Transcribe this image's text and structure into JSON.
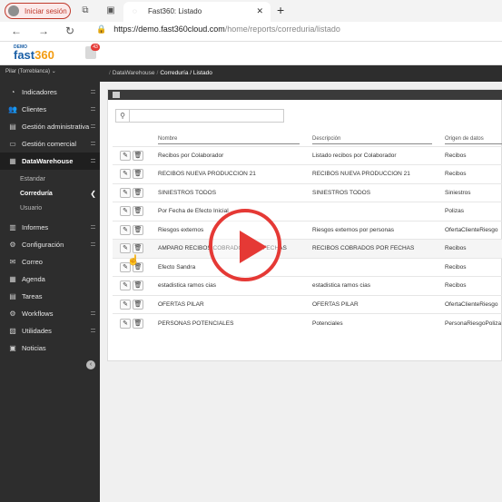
{
  "browser": {
    "signin_label": "Iniciar sesión",
    "tab_title": "Fast360: Listado",
    "tab_close": "✕",
    "new_tab": "+",
    "url_domain": "https://demo.fast360cloud.com",
    "url_path": "/home/reports/correduria/listado"
  },
  "header": {
    "logo_demo": "DEMO",
    "logo_fast": "fast",
    "logo_360": "360",
    "notif_count": "43"
  },
  "sidebar": {
    "user": "Pilar (Torreblanca)",
    "items": [
      {
        "label": "Indicadores",
        "icon": "dashboard-icon"
      },
      {
        "label": "Clientes",
        "icon": "users-icon"
      },
      {
        "label": "Gestión administrativa",
        "icon": "briefcase-icon"
      },
      {
        "label": "Gestión comercial",
        "icon": "monitor-icon"
      },
      {
        "label": "DataWarehouse",
        "icon": "database-icon"
      }
    ],
    "subitems": [
      "Estandar",
      "Correduría",
      "Usuario"
    ],
    "items2": [
      {
        "label": "Informes",
        "icon": "report-icon"
      },
      {
        "label": "Configuración",
        "icon": "gear-icon"
      },
      {
        "label": "Correo",
        "icon": "mail-icon"
      },
      {
        "label": "Agenda",
        "icon": "calendar-icon"
      },
      {
        "label": "Tareas",
        "icon": "tasks-icon"
      },
      {
        "label": "Workflows",
        "icon": "workflow-icon"
      },
      {
        "label": "Utilidades",
        "icon": "tools-icon"
      },
      {
        "label": "Noticias",
        "icon": "news-icon"
      }
    ]
  },
  "breadcrumb": {
    "part1": "DataWarehouse",
    "part2": "Correduría / Listado"
  },
  "table": {
    "headers": [
      "Nombre",
      "Descripción",
      "Origen de datos"
    ],
    "rows": [
      {
        "name": "Recibos por Colaborador",
        "desc": "Listado recibos por Colaborador",
        "origin": "Recibos"
      },
      {
        "name": "RECIBOS NUEVA PRODUCCION 21",
        "desc": "RECIBOS NUEVA PRODUCCION 21",
        "origin": "Recibos"
      },
      {
        "name": "SINIESTROS TODOS",
        "desc": "SINIESTROS TODOS",
        "origin": "Siniestros"
      },
      {
        "name": "Por Fecha de Efecto Inicial",
        "desc": "",
        "origin": "Polizas"
      },
      {
        "name": "Riesgos externos",
        "desc": "Riesgos externos por personas",
        "origin": "OfertaClienteRiesgo"
      },
      {
        "name": "AMPARO RECIBOS COBRADOS POR FECHAS",
        "desc": "RECIBOS COBRADOS POR FECHAS",
        "origin": "Recibos"
      },
      {
        "name": "Efecto Sandra",
        "desc": "",
        "origin": "Recibos"
      },
      {
        "name": "estadistica ramos cias",
        "desc": "estadistica ramos cias",
        "origin": "Recibos"
      },
      {
        "name": "OFERTAS PILAR",
        "desc": "OFERTAS PILAR",
        "origin": "OfertaClienteRiesgo"
      },
      {
        "name": "PERSONAS POTENCIALES",
        "desc": "Potenciales",
        "origin": "PersonaRiesgoPoliza"
      }
    ]
  }
}
